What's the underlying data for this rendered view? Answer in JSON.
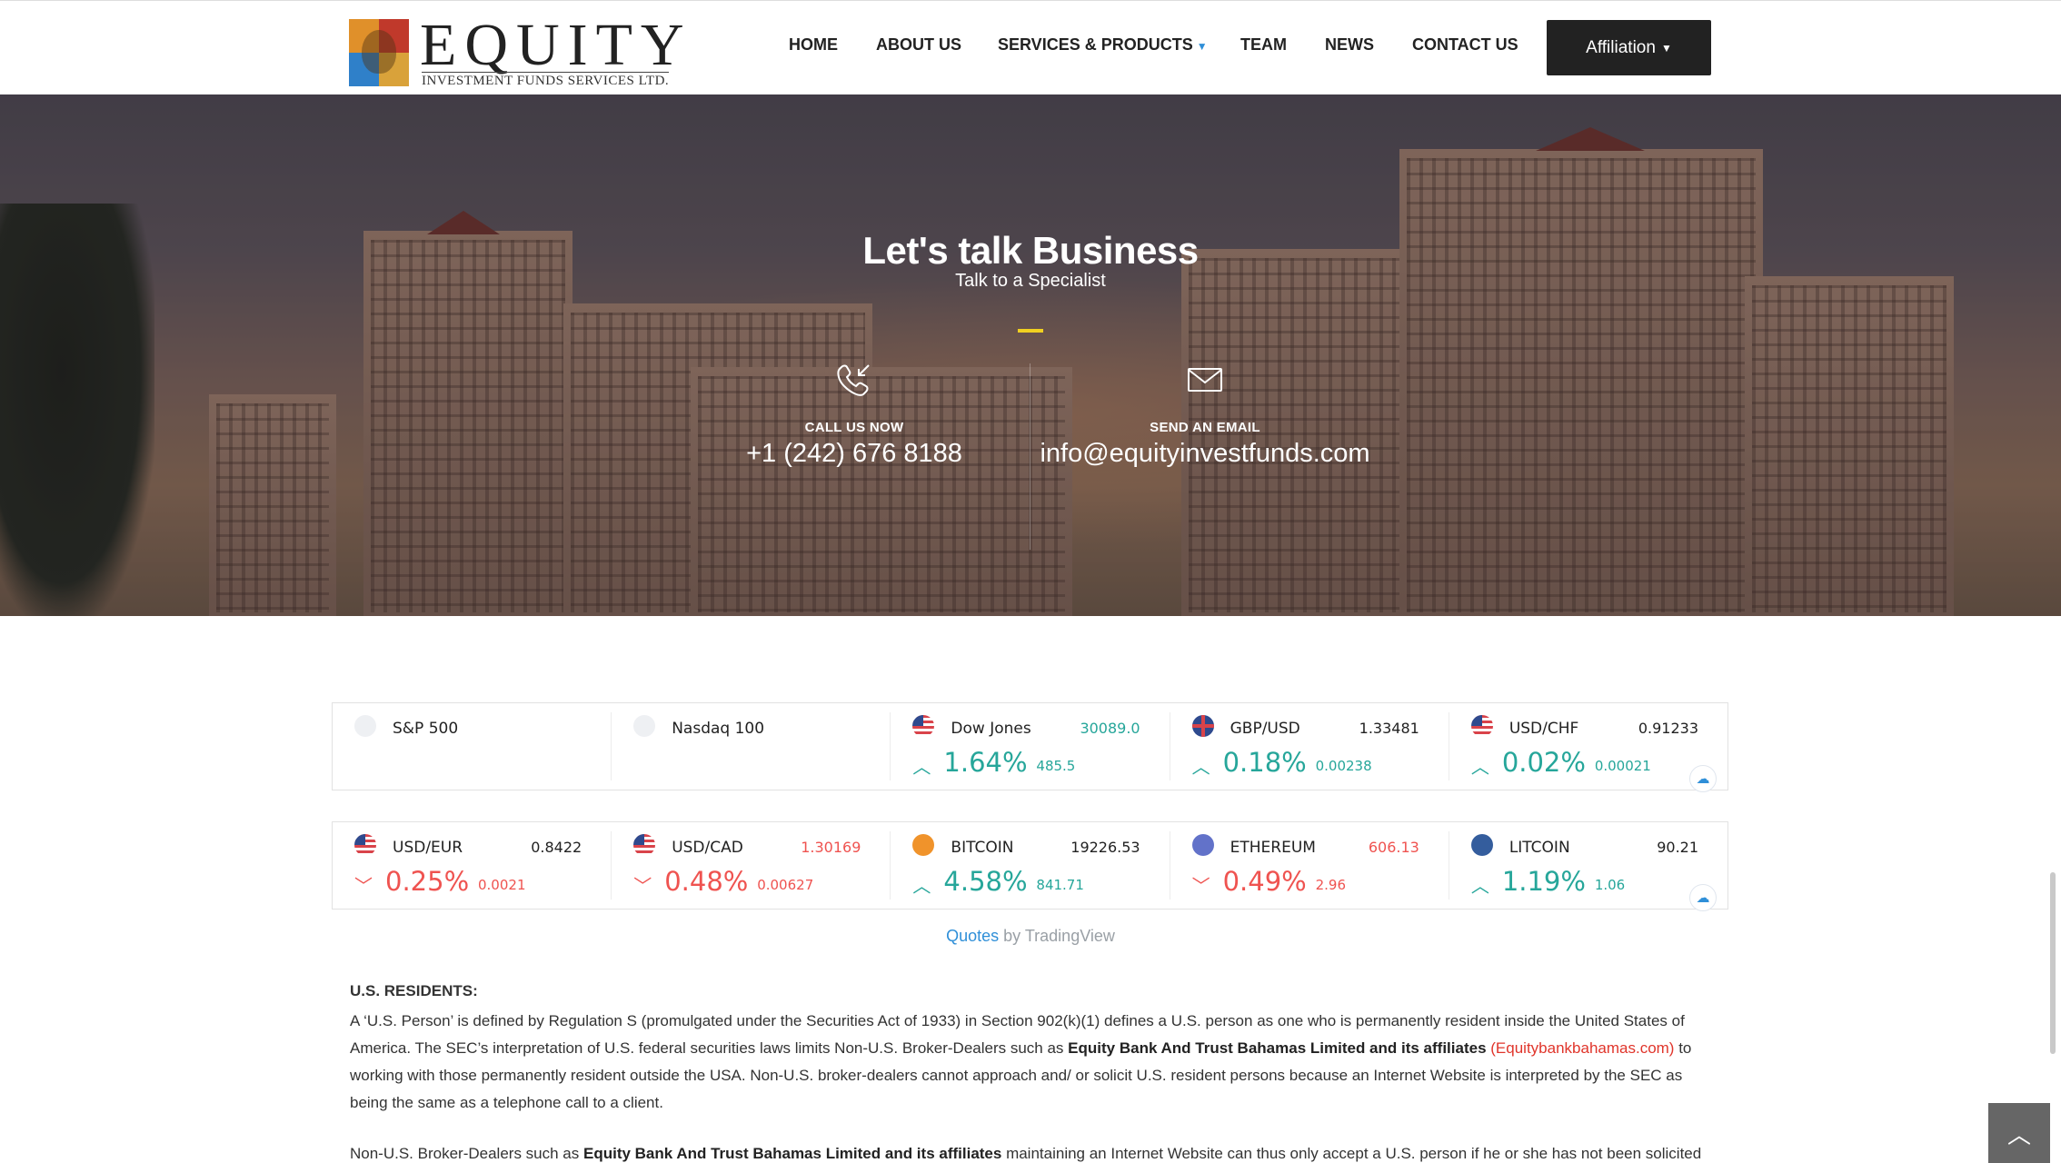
{
  "header": {
    "logo_word": "EQUITY",
    "logo_sub": "INVESTMENT FUNDS SERVICES LTD.",
    "nav": [
      {
        "label": "HOME"
      },
      {
        "label": "ABOUT US"
      },
      {
        "label": "SERVICES & PRODUCTS"
      },
      {
        "label": "TEAM"
      },
      {
        "label": "NEWS"
      },
      {
        "label": "CONTACT US"
      }
    ],
    "affiliation_label": "Affiliation"
  },
  "hero": {
    "title": "Let's talk Business",
    "subtitle": "Talk to a Specialist",
    "call": {
      "label": "CALL US NOW",
      "value": "+1 (242) 676 8188",
      "icon": "phone-icon"
    },
    "email": {
      "label": "SEND AN EMAIL",
      "value": "info@equityinvestfunds.com",
      "icon": "envelope-icon"
    }
  },
  "ticker_rows": [
    [
      {
        "name": "S&P 500",
        "price": "",
        "pct": "",
        "change": "",
        "dir": "none",
        "flag": "none"
      },
      {
        "name": "Nasdaq 100",
        "price": "",
        "pct": "",
        "change": "",
        "dir": "none",
        "flag": "none"
      },
      {
        "name": "Dow Jones",
        "price": "30089.0",
        "pct": "1.64%",
        "change": "485.5",
        "dir": "up",
        "flag": "us",
        "price_color": "up"
      },
      {
        "name": "GBP/USD",
        "price": "1.33481",
        "pct": "0.18%",
        "change": "0.00238",
        "dir": "up",
        "flag": "gb",
        "price_color": "dark"
      },
      {
        "name": "USD/CHF",
        "price": "0.91233",
        "pct": "0.02%",
        "change": "0.00021",
        "dir": "up",
        "flag": "us",
        "price_color": "dark"
      }
    ],
    [
      {
        "name": "USD/EUR",
        "price": "0.8422",
        "pct": "0.25%",
        "change": "0.0021",
        "dir": "dn",
        "flag": "us",
        "price_color": "dark"
      },
      {
        "name": "USD/CAD",
        "price": "1.30169",
        "pct": "0.48%",
        "change": "0.00627",
        "dir": "dn",
        "flag": "us",
        "price_color": "dn"
      },
      {
        "name": "BITCOIN",
        "price": "19226.53",
        "pct": "4.58%",
        "change": "841.71",
        "dir": "up",
        "flag": "btc",
        "price_color": "dark"
      },
      {
        "name": "ETHEREUM",
        "price": "606.13",
        "pct": "0.49%",
        "change": "2.96",
        "dir": "dn",
        "flag": "eth",
        "price_color": "dn"
      },
      {
        "name": "LITCOIN",
        "price": "90.21",
        "pct": "1.19%",
        "change": "1.06",
        "dir": "up",
        "flag": "ltc",
        "price_color": "dark"
      }
    ]
  ],
  "quotes": {
    "link": "Quotes",
    "rest": "by TradingView"
  },
  "legal": {
    "heading": "U.S. RESIDENTS:",
    "p1_a": "A ‘U.S. Person’ is defined by Regulation S (promulgated under the Securities Act of 1933) in Section 902(k)(1) defines a U.S. person as one who is permanently resident inside the United States of America. The SEC’s interpretation of U.S. federal securities laws limits Non-U.S. Broker-Dealers such as ",
    "p1_bold": "Equity Bank And Trust Bahamas Limited and its affiliates",
    "p1_link": "(Equitybankbahamas.com)",
    "p1_b": " to working with those permanently resident outside the USA. Non-U.S. broker-dealers cannot approach and/ or solicit U.S. resident persons because an Internet Website is interpreted by the SEC as being the same as a telephone call to a client.",
    "p2_a": "Non-U.S. Broker-Dealers such as ",
    "p2_bold": "Equity Bank And Trust Bahamas Limited and its affiliates",
    "p2_b": " maintaining an Internet Website can thus only accept a U.S. person if he or she has not been solicited"
  }
}
